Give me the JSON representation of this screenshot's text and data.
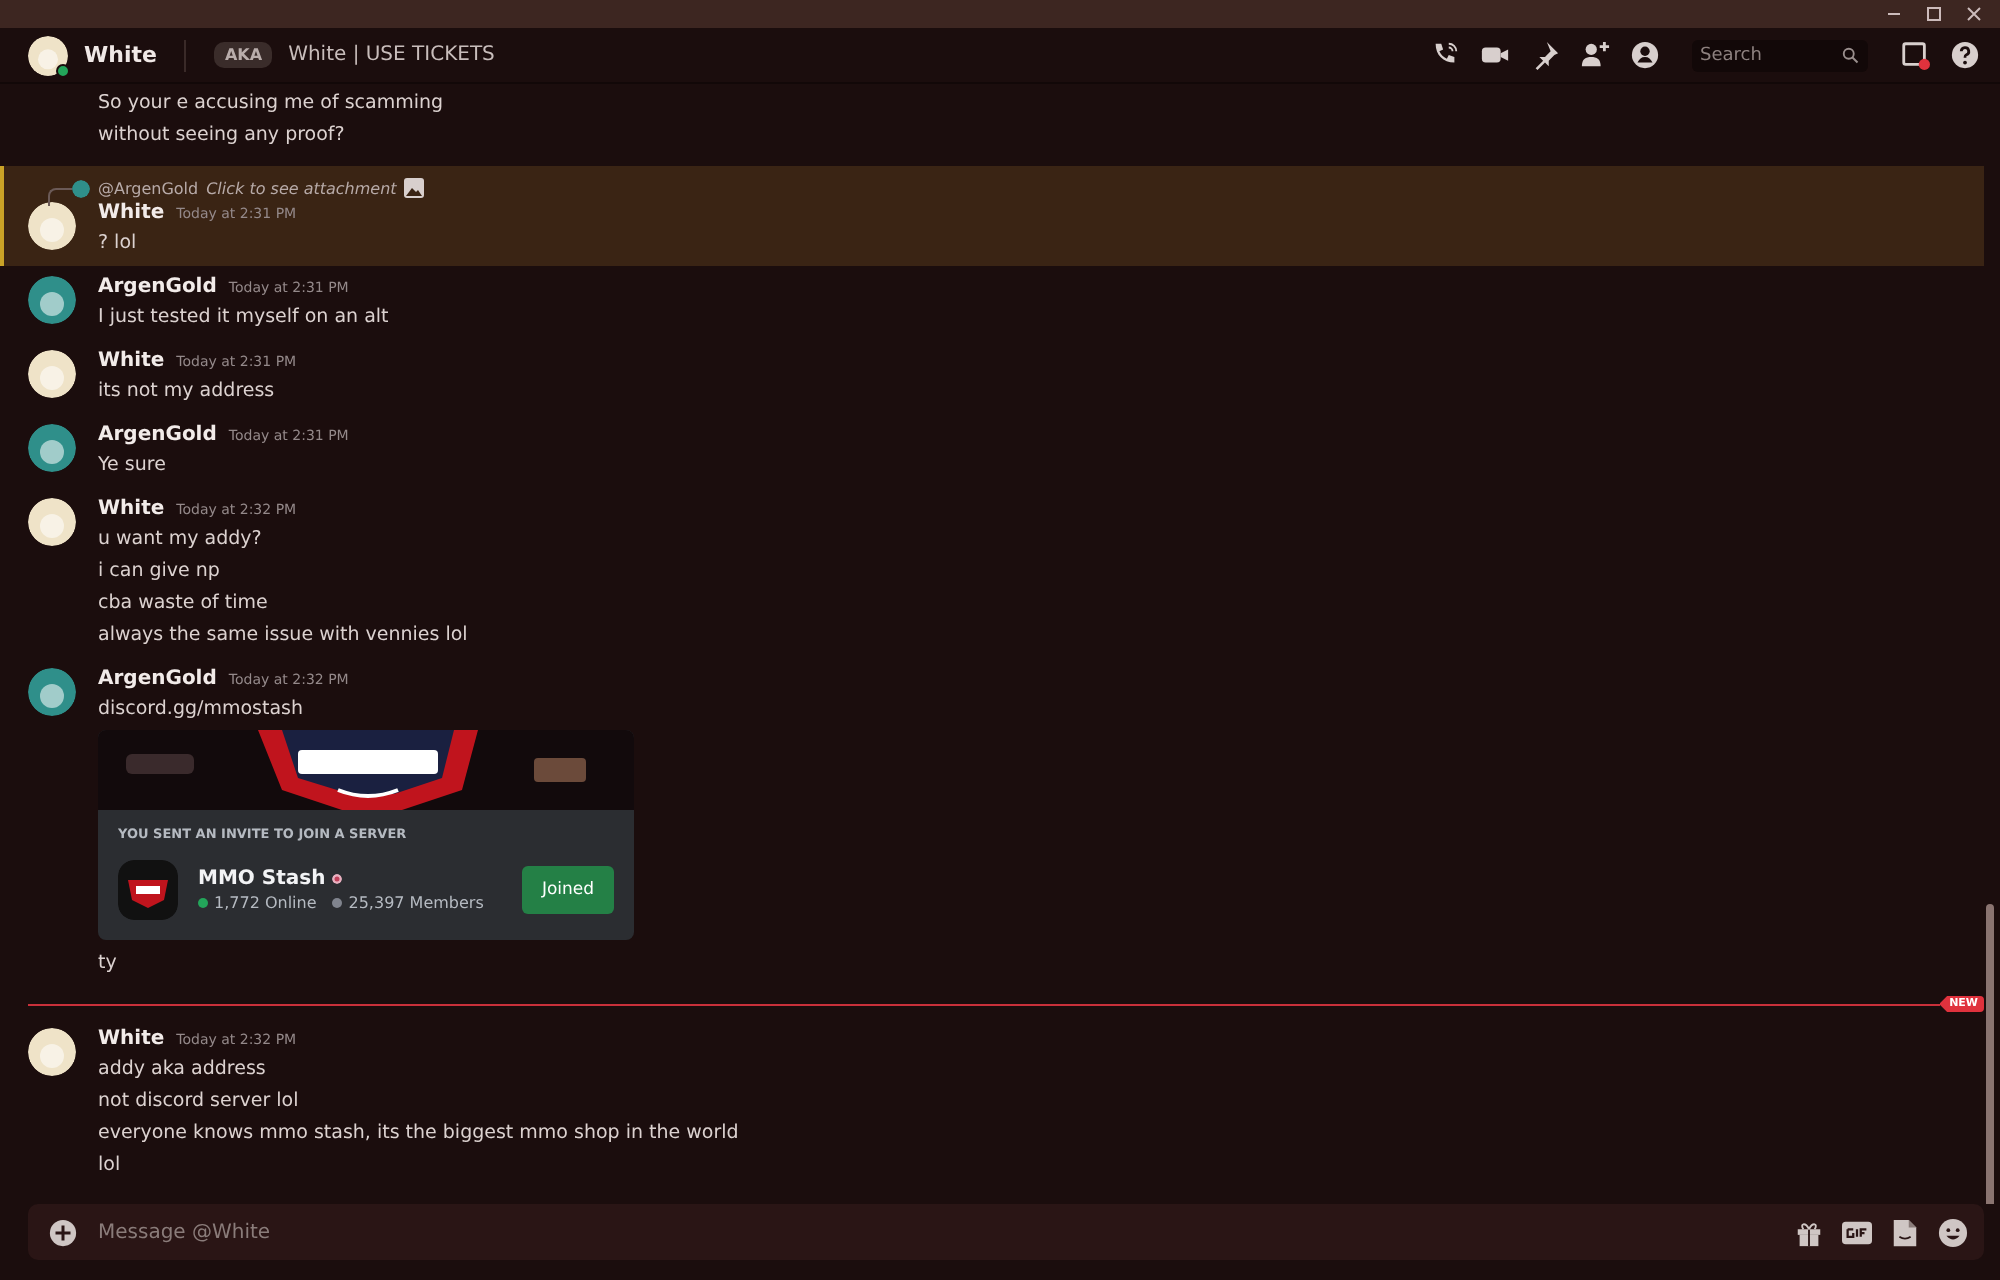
{
  "header": {
    "name": "White",
    "online": true,
    "aka_badge": "AKA",
    "aka_text": "White | USE TICKETS",
    "search": {
      "placeholder": "Search"
    }
  },
  "messages": [
    {
      "kind": "continuation",
      "lines": [
        "So your e accusing me of scamming",
        "without seeing any proof?"
      ]
    },
    {
      "kind": "reply",
      "highlighted": true,
      "reply_to": "@ArgenGold",
      "reply_text": "Click to see attachment",
      "author": "White",
      "color": "#efe3c8",
      "time": "Today at 2:31 PM",
      "lines": [
        "? lol"
      ]
    },
    {
      "kind": "message",
      "highlighted": false,
      "author": "ArgenGold",
      "color": "#2f8f8a",
      "time": "Today at 2:31 PM",
      "lines": [
        "I just tested it myself on an alt"
      ]
    },
    {
      "kind": "message",
      "highlighted": false,
      "author": "White",
      "color": "#efe3c8",
      "time": "Today at 2:31 PM",
      "lines": [
        "its not my address"
      ]
    },
    {
      "kind": "message",
      "highlighted": false,
      "author": "ArgenGold",
      "color": "#2f8f8a",
      "time": "Today at 2:31 PM",
      "lines": [
        "Ye sure"
      ]
    },
    {
      "kind": "message",
      "highlighted": false,
      "author": "White",
      "color": "#efe3c8",
      "time": "Today at 2:32 PM",
      "lines": [
        "u want my addy?",
        "i can give np",
        "cba waste of time",
        "always the same issue with vennies lol"
      ]
    },
    {
      "kind": "message",
      "highlighted": false,
      "author": "ArgenGold",
      "color": "#2f8f8a",
      "time": "Today at 2:32 PM",
      "lines": [
        "discord.gg/mmostash"
      ],
      "invite": {
        "heading": "YOU SENT AN INVITE TO JOIN A SERVER",
        "server": "MMO Stash",
        "online": "1,772 Online",
        "members": "25,397 Members",
        "button": "Joined",
        "joined": true
      },
      "after_lines": [
        "ty"
      ]
    },
    {
      "kind": "divider",
      "label": "NEW"
    },
    {
      "kind": "message",
      "highlighted": false,
      "author": "White",
      "color": "#efe3c8",
      "time": "Today at 2:32 PM",
      "lines": [
        "addy aka address",
        "not discord server lol",
        "everyone knows mmo stash, its the biggest mmo shop in the world",
        "lol"
      ]
    }
  ],
  "composer": {
    "placeholder": "Message @White"
  }
}
